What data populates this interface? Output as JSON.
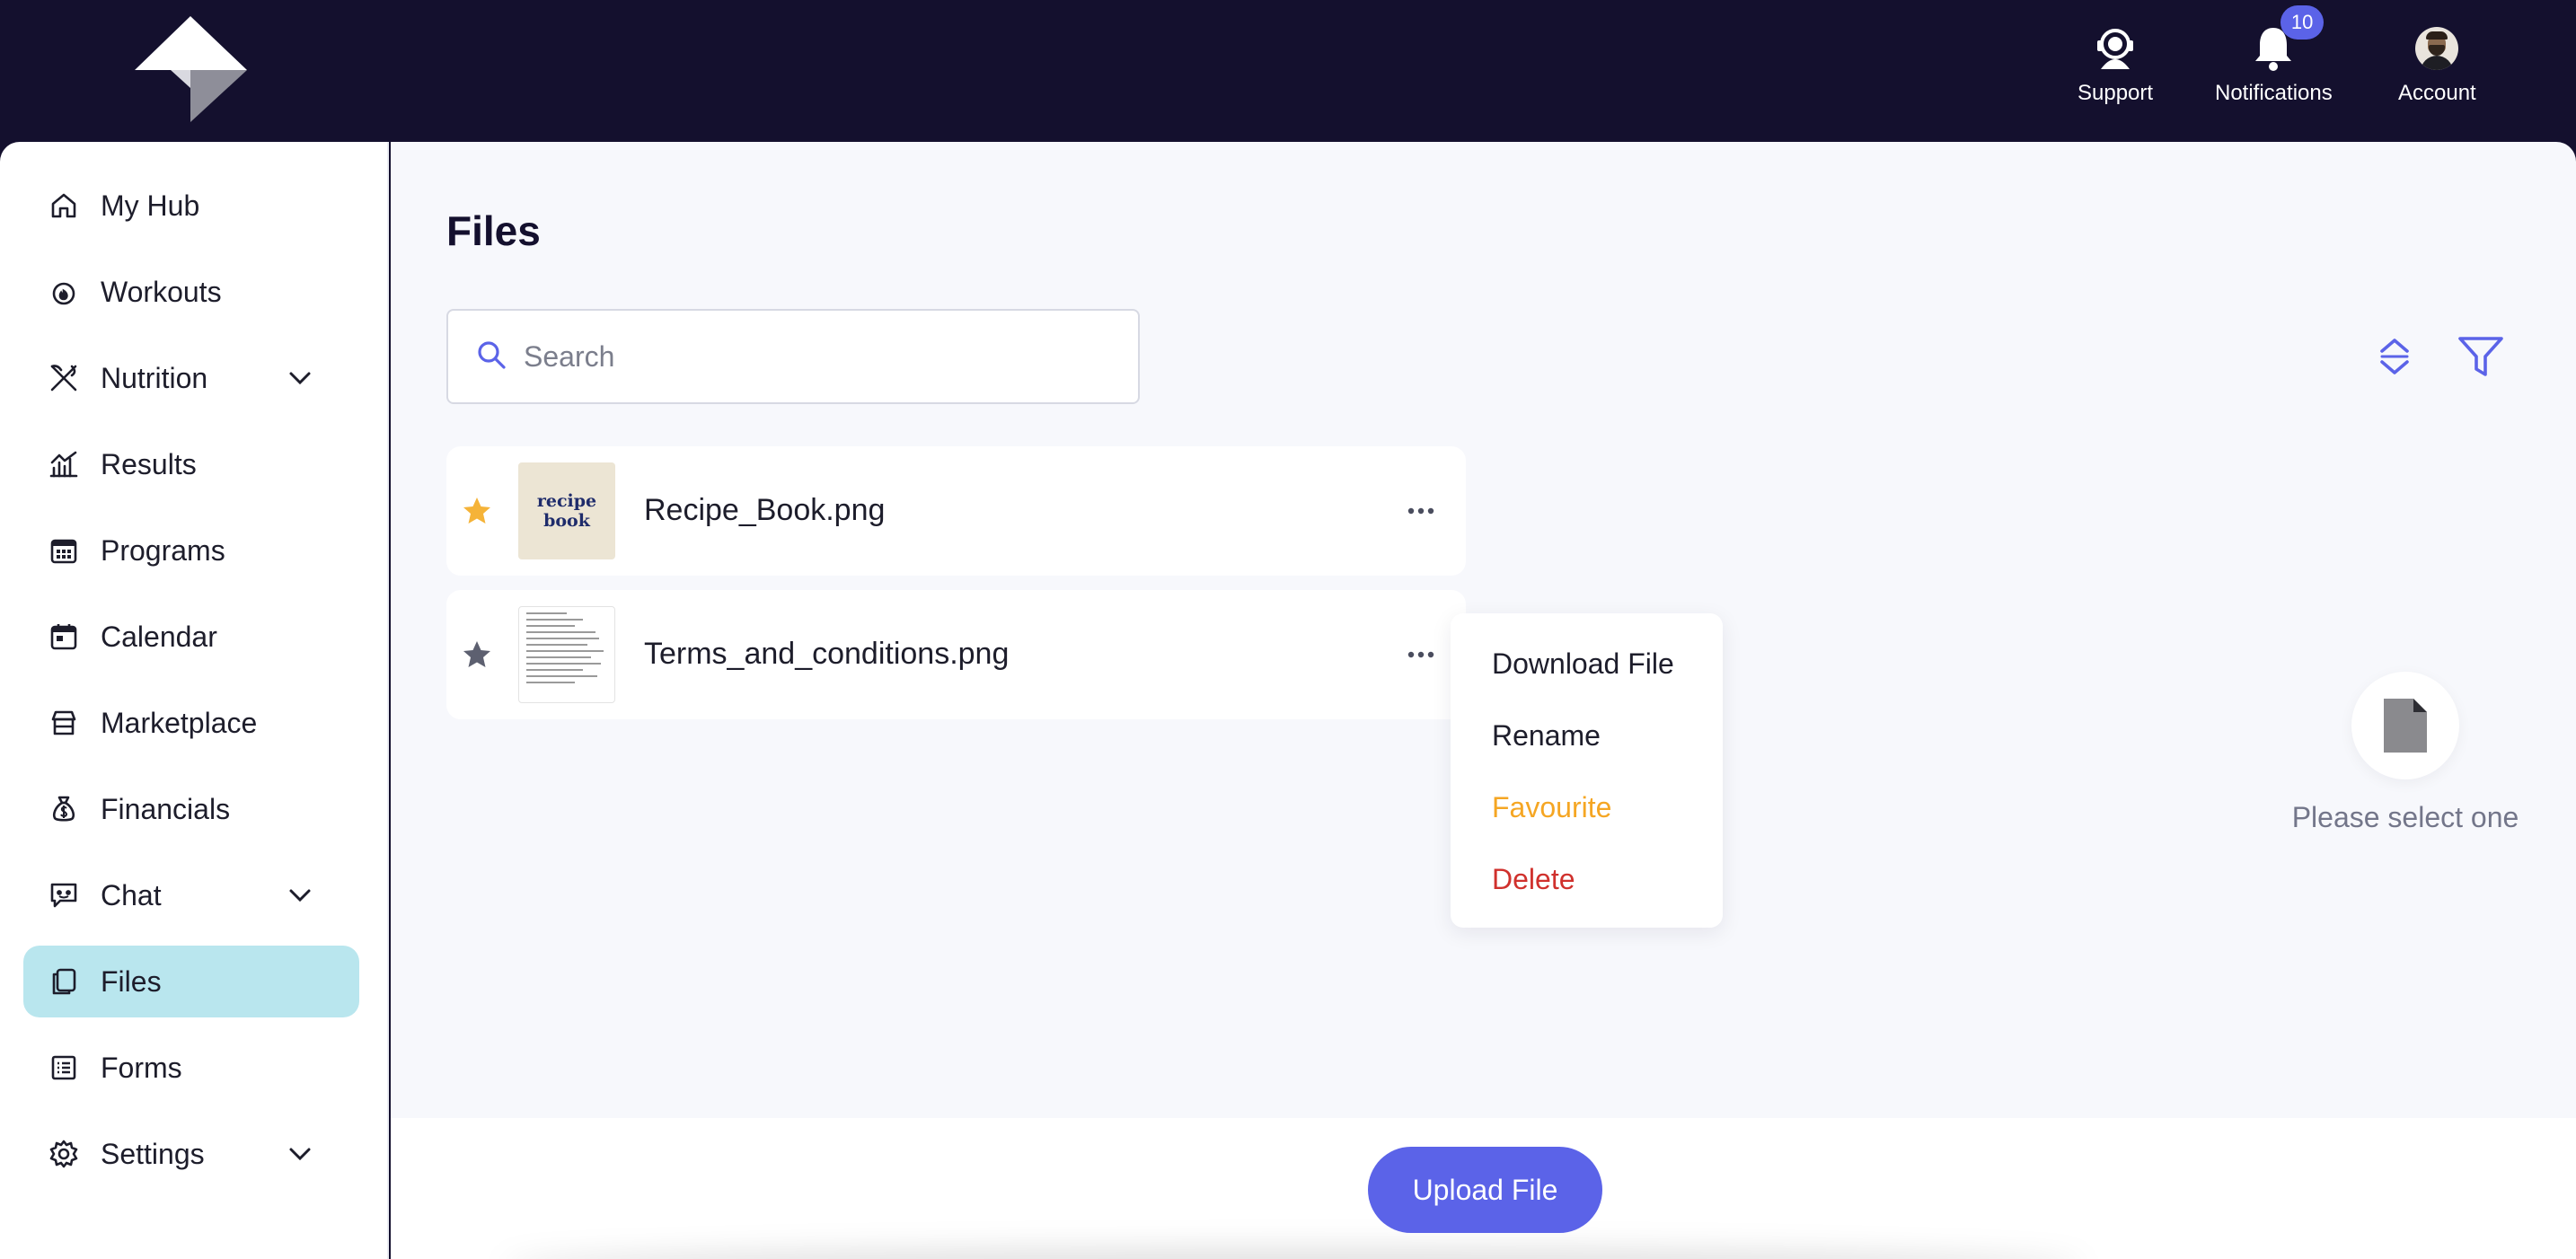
{
  "header": {
    "support_label": "Support",
    "notifications_label": "Notifications",
    "notifications_count": "10",
    "account_label": "Account",
    "background_color": "#14102e"
  },
  "sidebar": {
    "items": [
      {
        "label": "My Hub",
        "icon": "home-icon"
      },
      {
        "label": "Workouts",
        "icon": "flame-icon"
      },
      {
        "label": "Nutrition",
        "icon": "utensils-icon",
        "expandable": true
      },
      {
        "label": "Results",
        "icon": "chart-icon"
      },
      {
        "label": "Programs",
        "icon": "grid-calendar-icon"
      },
      {
        "label": "Calendar",
        "icon": "calendar-icon"
      },
      {
        "label": "Marketplace",
        "icon": "store-icon"
      },
      {
        "label": "Financials",
        "icon": "money-bag-icon"
      },
      {
        "label": "Chat",
        "icon": "chat-icon",
        "expandable": true
      },
      {
        "label": "Files",
        "icon": "files-icon",
        "active": true
      },
      {
        "label": "Forms",
        "icon": "form-icon"
      },
      {
        "label": "Settings",
        "icon": "gear-icon",
        "expandable": true
      }
    ],
    "active_color": "#b9e6ee"
  },
  "main": {
    "title": "Files",
    "search": {
      "placeholder": "Search",
      "value": ""
    },
    "files": [
      {
        "name": "Recipe_Book.png",
        "favourite": true,
        "thumb_text_1": "recipe",
        "thumb_text_2": "book"
      },
      {
        "name": "Terms_and_conditions.png",
        "favourite": false
      }
    ],
    "context_menu": {
      "download": "Download File",
      "rename": "Rename",
      "favourite": "Favourite",
      "delete": "Delete",
      "favourite_color": "#f5a623",
      "delete_color": "#d0312d"
    },
    "empty_state": {
      "text": "Please select one"
    },
    "upload_label": "Upload File",
    "accent_color": "#5b63e8"
  }
}
